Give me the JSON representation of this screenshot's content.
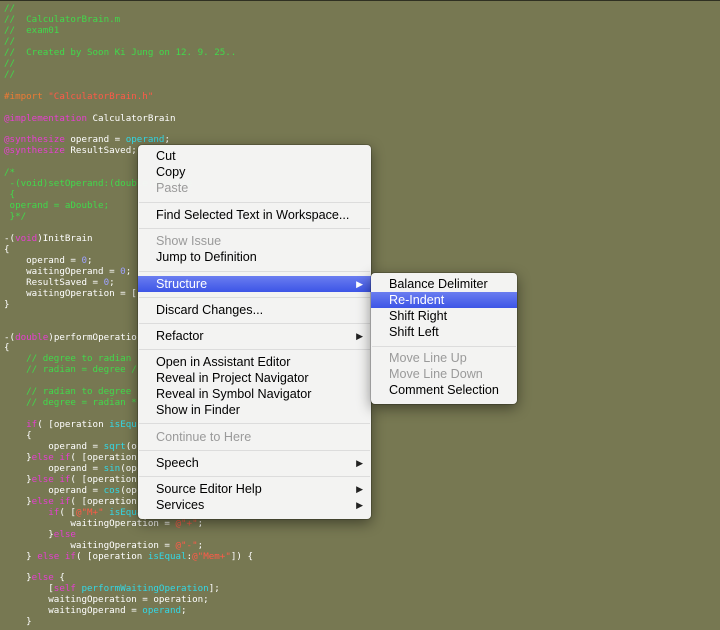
{
  "code": {
    "lines": [
      [
        [
          "//",
          "c-com"
        ]
      ],
      [
        [
          "//  CalculatorBrain.m",
          "c-com"
        ]
      ],
      [
        [
          "//  exam01",
          "c-com"
        ]
      ],
      [
        [
          "//",
          "c-com"
        ]
      ],
      [
        [
          "//  Created by Soon Ki Jung on 12. 9. 25..",
          "c-com"
        ]
      ],
      [
        [
          "//",
          "c-com"
        ]
      ],
      [
        [
          "//",
          "c-com"
        ]
      ],
      [
        [
          "",
          "c-def"
        ]
      ],
      [
        [
          "#import ",
          "c-dir"
        ],
        [
          "\"CalculatorBrain.h\"",
          "c-str"
        ]
      ],
      [
        [
          "",
          "c-def"
        ]
      ],
      [
        [
          "@implementation",
          "c-kw"
        ],
        [
          " CalculatorBrain",
          "c-def"
        ]
      ],
      [
        [
          "",
          "c-def"
        ]
      ],
      [
        [
          "@synthesize",
          "c-kw"
        ],
        [
          " operand = ",
          "c-def"
        ],
        [
          "operand",
          "c-meth"
        ],
        [
          ";",
          "c-def"
        ]
      ],
      [
        [
          "@synthesize",
          "c-kw"
        ],
        [
          " ResultSaved;",
          "c-def"
        ]
      ],
      [
        [
          "",
          "c-def"
        ]
      ],
      [
        [
          "/*",
          "c-com"
        ]
      ],
      [
        [
          " -(void)setOperand:(double)aDouble",
          "c-com"
        ]
      ],
      [
        [
          " {",
          "c-com"
        ]
      ],
      [
        [
          " operand = aDouble;",
          "c-com"
        ]
      ],
      [
        [
          " }*/",
          "c-com"
        ]
      ],
      [
        [
          "",
          "c-def"
        ]
      ],
      [
        [
          "-(",
          "c-def"
        ],
        [
          "void",
          "c-kw"
        ],
        [
          ")InitBrain",
          "c-def"
        ]
      ],
      [
        [
          "{",
          "c-def"
        ]
      ],
      [
        [
          "    operand = ",
          "c-def"
        ],
        [
          "0",
          "c-num"
        ],
        [
          ";",
          "c-def"
        ]
      ],
      [
        [
          "    waitingOperand = ",
          "c-def"
        ],
        [
          "0",
          "c-num"
        ],
        [
          ";",
          "c-def"
        ]
      ],
      [
        [
          "    ResultSaved = ",
          "c-def"
        ],
        [
          "0",
          "c-num"
        ],
        [
          ";",
          "c-def"
        ]
      ],
      [
        [
          "    waitingOperation = [",
          "c-def"
        ]
      ],
      [
        [
          "}",
          "c-def"
        ]
      ],
      [
        [
          "",
          "c-def"
        ]
      ],
      [
        [
          "",
          "c-def"
        ]
      ],
      [
        [
          "-(",
          "c-def"
        ],
        [
          "double",
          "c-kw"
        ],
        [
          ")performOperatio",
          "c-def"
        ]
      ],
      [
        [
          "{",
          "c-def"
        ]
      ],
      [
        [
          "    // degree to radian",
          "c-com"
        ]
      ],
      [
        [
          "    // radian = degree /",
          "c-com"
        ]
      ],
      [
        [
          "",
          "c-def"
        ]
      ],
      [
        [
          "    // radian to degree",
          "c-com"
        ]
      ],
      [
        [
          "    // degree = radian *",
          "c-com"
        ]
      ],
      [
        [
          "",
          "c-def"
        ]
      ],
      [
        [
          "    ",
          "c-def"
        ],
        [
          "if",
          "c-kw"
        ],
        [
          "( [operation ",
          "c-def"
        ],
        [
          "isEqu",
          "c-meth"
        ]
      ],
      [
        [
          "    {",
          "c-def"
        ]
      ],
      [
        [
          "        operand = ",
          "c-def"
        ],
        [
          "sqrt",
          "c-meth"
        ],
        [
          "(o",
          "c-def"
        ]
      ],
      [
        [
          "    }",
          "c-def"
        ],
        [
          "else if",
          "c-kw"
        ],
        [
          "( [operation",
          "c-def"
        ]
      ],
      [
        [
          "        operand = ",
          "c-def"
        ],
        [
          "sin",
          "c-meth"
        ],
        [
          "(op",
          "c-def"
        ]
      ],
      [
        [
          "    }",
          "c-def"
        ],
        [
          "else if",
          "c-kw"
        ],
        [
          "( [operation",
          "c-def"
        ]
      ],
      [
        [
          "        operand = ",
          "c-def"
        ],
        [
          "cos",
          "c-meth"
        ],
        [
          "(op",
          "c-def"
        ]
      ],
      [
        [
          "    }",
          "c-def"
        ],
        [
          "else if",
          "c-kw"
        ],
        [
          "( [operation",
          "c-def"
        ]
      ],
      [
        [
          "        ",
          "c-def"
        ],
        [
          "if",
          "c-kw"
        ],
        [
          "( [",
          "c-def"
        ],
        [
          "@\"M+\"",
          "c-str"
        ],
        [
          " ",
          "c-def"
        ],
        [
          "isEqua",
          "c-meth"
        ]
      ],
      [
        [
          "            waitingOperation = ",
          "c-def"
        ],
        [
          "@\"+\"",
          "c-str"
        ],
        [
          ";",
          "c-def"
        ]
      ],
      [
        [
          "        }",
          "c-def"
        ],
        [
          "else",
          "c-kw"
        ]
      ],
      [
        [
          "            waitingOperation = ",
          "c-def"
        ],
        [
          "@\"-\"",
          "c-str"
        ],
        [
          ";",
          "c-def"
        ]
      ],
      [
        [
          "    } ",
          "c-def"
        ],
        [
          "else if",
          "c-kw"
        ],
        [
          "( [operation ",
          "c-def"
        ],
        [
          "isEqual",
          "c-meth"
        ],
        [
          ":",
          "c-def"
        ],
        [
          "@\"Mem+\"",
          "c-str"
        ],
        [
          "]) {",
          "c-def"
        ]
      ],
      [
        [
          "",
          "c-def"
        ]
      ],
      [
        [
          "    }",
          "c-def"
        ],
        [
          "else",
          "c-kw"
        ],
        [
          " {",
          "c-def"
        ]
      ],
      [
        [
          "        [",
          "c-def"
        ],
        [
          "self",
          "c-self"
        ],
        [
          " ",
          "c-def"
        ],
        [
          "performWaitingOperation",
          "c-meth"
        ],
        [
          "];",
          "c-def"
        ]
      ],
      [
        [
          "        waitingOperation = operation;",
          "c-def"
        ]
      ],
      [
        [
          "        waitingOperand = ",
          "c-def"
        ],
        [
          "operand",
          "c-meth"
        ],
        [
          ";",
          "c-def"
        ]
      ],
      [
        [
          "    }",
          "c-def"
        ]
      ]
    ]
  },
  "context_menu": {
    "items": [
      {
        "type": "item",
        "label": "Cut",
        "enabled": true,
        "name": "menu-item-cut"
      },
      {
        "type": "item",
        "label": "Copy",
        "enabled": true,
        "name": "menu-item-copy"
      },
      {
        "type": "item",
        "label": "Paste",
        "enabled": false,
        "name": "menu-item-paste"
      },
      {
        "type": "sep"
      },
      {
        "type": "item",
        "label": "Find Selected Text in Workspace...",
        "enabled": true,
        "name": "menu-item-find-selected-text"
      },
      {
        "type": "sep"
      },
      {
        "type": "item",
        "label": "Show Issue",
        "enabled": false,
        "name": "menu-item-show-issue"
      },
      {
        "type": "item",
        "label": "Jump to Definition",
        "enabled": true,
        "name": "menu-item-jump-to-definition"
      },
      {
        "type": "sep"
      },
      {
        "type": "item",
        "label": "Structure",
        "enabled": true,
        "submenu": true,
        "highlighted": true,
        "name": "menu-item-structure"
      },
      {
        "type": "sep"
      },
      {
        "type": "item",
        "label": "Discard Changes...",
        "enabled": true,
        "name": "menu-item-discard-changes"
      },
      {
        "type": "sep"
      },
      {
        "type": "item",
        "label": "Refactor",
        "enabled": true,
        "submenu": true,
        "name": "menu-item-refactor"
      },
      {
        "type": "sep"
      },
      {
        "type": "item",
        "label": "Open in Assistant Editor",
        "enabled": true,
        "name": "menu-item-open-assistant-editor"
      },
      {
        "type": "item",
        "label": "Reveal in Project Navigator",
        "enabled": true,
        "name": "menu-item-reveal-project-navigator"
      },
      {
        "type": "item",
        "label": "Reveal in Symbol Navigator",
        "enabled": true,
        "name": "menu-item-reveal-symbol-navigator"
      },
      {
        "type": "item",
        "label": "Show in Finder",
        "enabled": true,
        "name": "menu-item-show-in-finder"
      },
      {
        "type": "sep"
      },
      {
        "type": "item",
        "label": "Continue to Here",
        "enabled": false,
        "name": "menu-item-continue-to-here"
      },
      {
        "type": "sep"
      },
      {
        "type": "item",
        "label": "Speech",
        "enabled": true,
        "submenu": true,
        "name": "menu-item-speech"
      },
      {
        "type": "sep"
      },
      {
        "type": "item",
        "label": "Source Editor Help",
        "enabled": true,
        "submenu": true,
        "name": "menu-item-source-editor-help"
      },
      {
        "type": "item",
        "label": "Services",
        "enabled": true,
        "submenu": true,
        "name": "menu-item-services"
      }
    ]
  },
  "submenu": {
    "items": [
      {
        "type": "item",
        "label": "Balance Delimiter",
        "enabled": true,
        "name": "submenu-item-balance-delimiter"
      },
      {
        "type": "item",
        "label": "Re-Indent",
        "enabled": true,
        "highlighted": true,
        "name": "submenu-item-re-indent"
      },
      {
        "type": "item",
        "label": "Shift Right",
        "enabled": true,
        "name": "submenu-item-shift-right"
      },
      {
        "type": "item",
        "label": "Shift Left",
        "enabled": true,
        "name": "submenu-item-shift-left"
      },
      {
        "type": "sep"
      },
      {
        "type": "item",
        "label": "Move Line Up",
        "enabled": false,
        "name": "submenu-item-move-line-up"
      },
      {
        "type": "item",
        "label": "Move Line Down",
        "enabled": false,
        "name": "submenu-item-move-line-down"
      },
      {
        "type": "item",
        "label": "Comment Selection",
        "enabled": true,
        "name": "submenu-item-comment-selection"
      }
    ]
  },
  "icons": {
    "submenu_arrow": "▶"
  }
}
